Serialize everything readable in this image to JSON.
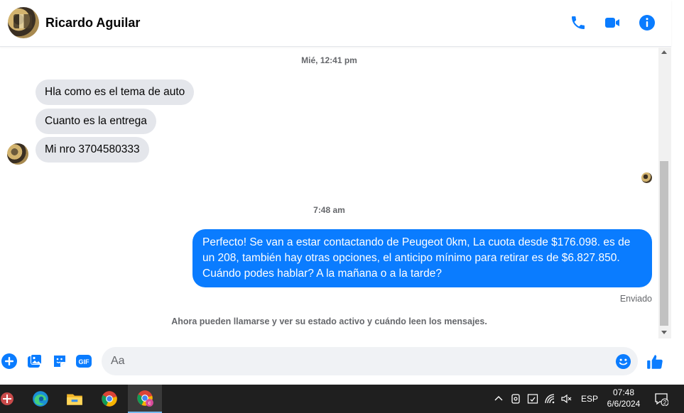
{
  "header": {
    "contact_name": "Ricardo Aguilar"
  },
  "conversation": {
    "timestamp_1": "Mié, 12:41 pm",
    "incoming_messages": [
      "Hla como es el tema de auto",
      "Cuanto es la entrega",
      "Mi nro 3704580333"
    ],
    "timestamp_2": "7:48 am",
    "outgoing_message": "Perfecto!  Se van a estar contactando de Peugeot 0km, La cuota desde $176.098. es de un 208, también hay otras opciones, el anticipo mínimo para retirar es de $6.827.850. Cuándo podes hablar? A la mañana o a la tarde?",
    "sent_status": "Enviado",
    "info_notice": "Ahora pueden llamarse y ver su estado activo y cuándo leen los mensajes."
  },
  "composer": {
    "placeholder": "Aa"
  },
  "taskbar": {
    "language": "ESP",
    "time": "07:48",
    "date": "6/6/2024",
    "notification_count": "2"
  },
  "colors": {
    "accent": "#0a7cff",
    "incoming_bubble": "#e4e6eb",
    "taskbar_bg": "#1f1f1f"
  }
}
